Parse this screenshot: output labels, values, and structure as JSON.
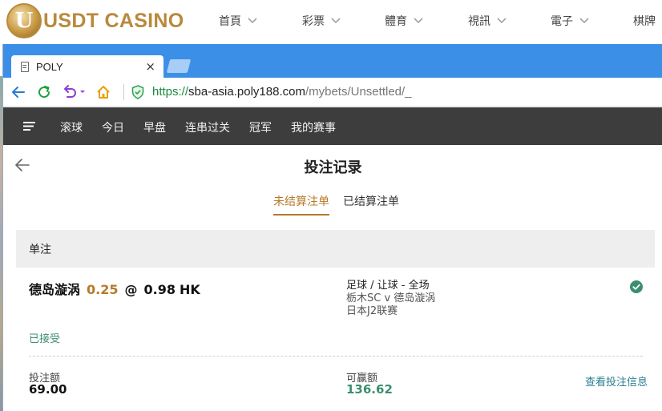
{
  "site": {
    "logo_letter": "U",
    "logo_text": "USDT CASINO",
    "brand_color": "#b88a3d",
    "nav": [
      {
        "label": "首頁"
      },
      {
        "label": "彩票"
      },
      {
        "label": "體育"
      },
      {
        "label": "視訊"
      },
      {
        "label": "電子"
      },
      {
        "label": "棋牌"
      }
    ]
  },
  "browser": {
    "tab_title": "POLY",
    "tab_close": "×",
    "url_scheme": "https://",
    "url_host": "sba-asia.poly188.com",
    "url_path": "/mybets/Unsettled/_",
    "tabbar_color": "#3c8fe6",
    "icons": [
      "back-icon",
      "refresh-icon",
      "undo-icon",
      "home-icon",
      "security-shield-icon"
    ]
  },
  "app": {
    "nav": [
      {
        "label": "滚球"
      },
      {
        "label": "今日"
      },
      {
        "label": "早盘"
      },
      {
        "label": "连串过关"
      },
      {
        "label": "冠军"
      },
      {
        "label": "我的赛事"
      }
    ],
    "page_title": "投注记录",
    "tabs": [
      {
        "label": "未结算注单",
        "active": true
      },
      {
        "label": "已结算注单",
        "active": false
      }
    ],
    "section_title": "单注",
    "bet": {
      "selection": "德岛漩涡",
      "handicap": "0.25",
      "at": "@",
      "odds": "0.98",
      "odds_type": "HK",
      "market": "足球 / 让球 - 全场",
      "teams": "栃木SC v 德岛漩涡",
      "league": "日本J2联赛",
      "status": "已接受",
      "stake_label": "投注额",
      "stake_value": "69.00",
      "win_label": "可赢额",
      "win_value": "136.62",
      "details_link": "查看投注信息"
    },
    "accent_color": "#b77a2a",
    "success_color": "#3a8f6e"
  }
}
